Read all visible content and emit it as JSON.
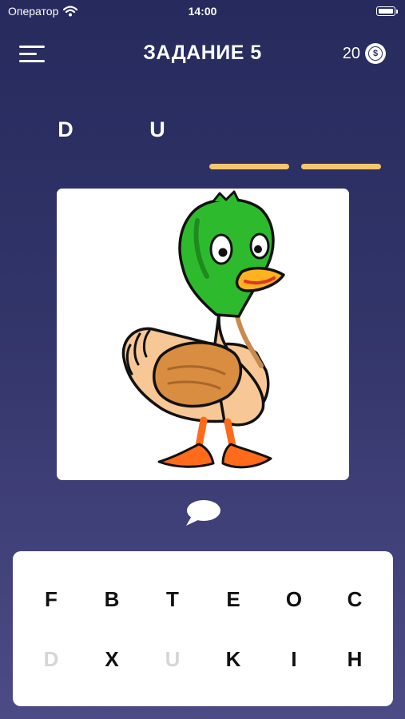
{
  "status_bar": {
    "carrier": "Оператор",
    "time": "14:00"
  },
  "header": {
    "title": "ЗАДАНИЕ 5",
    "coins": "20",
    "coin_symbol": "$"
  },
  "answer_slots": [
    {
      "letter": "D",
      "filled": true
    },
    {
      "letter": "U",
      "filled": true
    },
    {
      "letter": "",
      "filled": false
    },
    {
      "letter": "",
      "filled": false
    }
  ],
  "picture": {
    "subject": "duck-illustration"
  },
  "hint": {
    "icon": "speech-bubble-icon"
  },
  "keyboard": {
    "rows": [
      [
        {
          "letter": "F",
          "used": false
        },
        {
          "letter": "B",
          "used": false
        },
        {
          "letter": "T",
          "used": false
        },
        {
          "letter": "E",
          "used": false
        },
        {
          "letter": "O",
          "used": false
        },
        {
          "letter": "C",
          "used": false
        }
      ],
      [
        {
          "letter": "D",
          "used": true
        },
        {
          "letter": "X",
          "used": false
        },
        {
          "letter": "U",
          "used": true
        },
        {
          "letter": "K",
          "used": false
        },
        {
          "letter": "I",
          "used": false
        },
        {
          "letter": "H",
          "used": false
        }
      ]
    ]
  },
  "colors": {
    "accent_line": "#f5c66e",
    "background_top": "#262a5d",
    "background_bottom": "#4d4b86",
    "used_key": "#d6d6d9"
  }
}
